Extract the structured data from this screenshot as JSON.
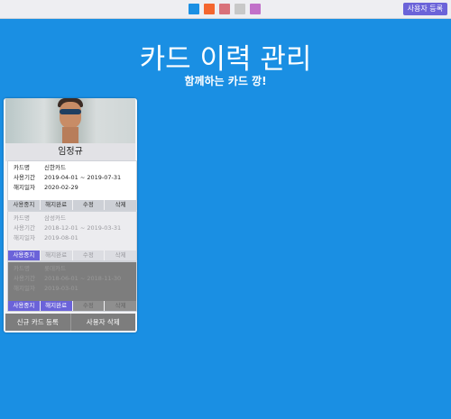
{
  "topbar": {
    "swatches": [
      {
        "name": "blue",
        "color": "#1a8fe3"
      },
      {
        "name": "orange",
        "color": "#f4662f"
      },
      {
        "name": "rose",
        "color": "#d9717a"
      },
      {
        "name": "gray",
        "color": "#c8c8c8"
      },
      {
        "name": "purple",
        "color": "#c170c9"
      }
    ],
    "register_button": "사용자 등록"
  },
  "header": {
    "title": "카드 이력 관리",
    "subtitle": "함께하는 카드 깡!"
  },
  "card": {
    "user_name": "임정규",
    "photo_icon": "user-photo",
    "field_labels": {
      "card_name": "카드명",
      "period": "사용기간",
      "cancel_date": "해지일자"
    },
    "entries": [
      {
        "card_name": "신한카드",
        "period": "2019-04-01 ~ 2019-07-31",
        "cancel_date": "2020-02-29",
        "buttons": [
          "사용중지",
          "해지완료",
          "수정",
          "삭제"
        ],
        "active_buttons": []
      },
      {
        "card_name": "삼성카드",
        "period": "2018-12-01 ~ 2019-03-31",
        "cancel_date": "2019-08-01",
        "buttons": [
          "사용중지",
          "해지완료",
          "수정",
          "삭제"
        ],
        "active_buttons": [
          0
        ]
      },
      {
        "card_name": "롯데카드",
        "period": "2018-06-01 ~ 2018-11-30",
        "cancel_date": "2019-03-01",
        "buttons": [
          "사용중지",
          "해지완료",
          "수정",
          "삭제"
        ],
        "active_buttons": [
          0,
          1
        ]
      }
    ],
    "footer": {
      "new_card": "신규 카드 등록",
      "delete_user": "사용자 삭제"
    }
  }
}
